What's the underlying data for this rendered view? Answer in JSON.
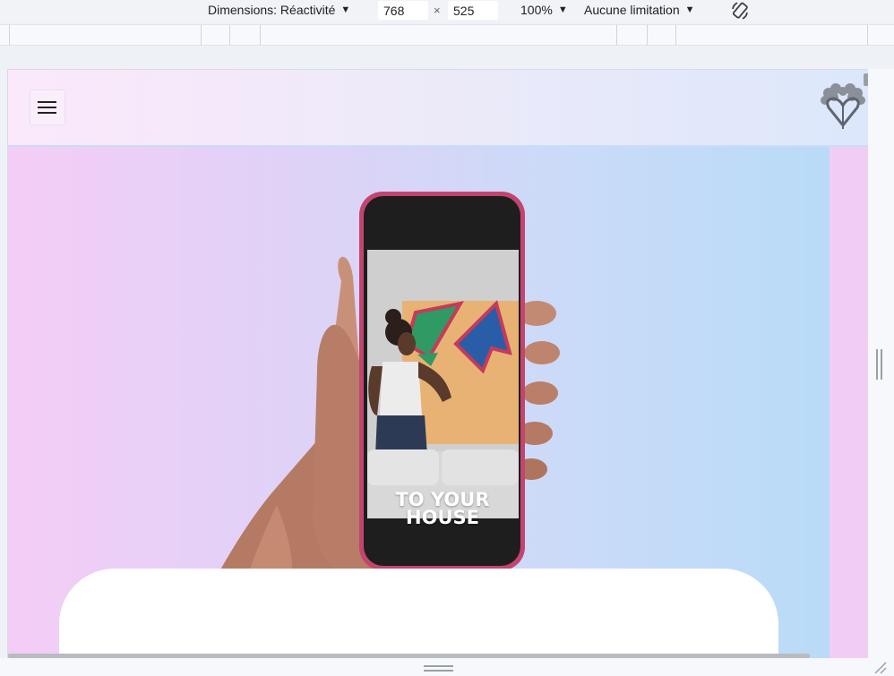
{
  "toolbar": {
    "dimensions_label": "Dimensions: Réactivité",
    "width_value": "768",
    "height_value": "525",
    "times_symbol": "×",
    "zoom_label": "100%",
    "throttle_label": "Aucune limitation",
    "caret": "▼",
    "rotate_icon": "rotate-icon"
  },
  "site": {
    "menu_icon": "hamburger-menu-icon",
    "logo_icon": "tree-heart-logo-icon",
    "hero_phone_text_line1": "TO YOUR",
    "hero_phone_text_line2": "HOUSE"
  },
  "colors": {
    "header_start": "#fbe8fb",
    "header_end": "#dce7fb",
    "hero_start": "#f4cdf6",
    "hero_end": "#b9dbf7",
    "phone_frame": "#c2456f"
  }
}
